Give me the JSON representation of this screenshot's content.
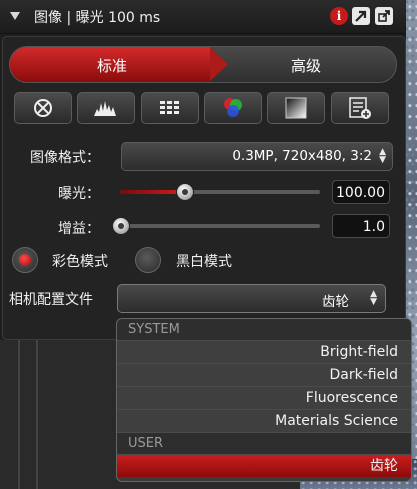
{
  "titlebar": {
    "title": "图像 | 曝光 100 ms"
  },
  "mode_tabs": {
    "standard": "标准",
    "advanced": "高级",
    "active": "标准"
  },
  "toolbar": {
    "icons": [
      "auto-exposure-icon",
      "histogram-icon",
      "grid-icon",
      "color-balance-icon",
      "white-balance-icon",
      "settings-list-icon"
    ]
  },
  "image_format": {
    "label": "图像格式：",
    "value": "0.3MP, 720x480, 3:2"
  },
  "exposure": {
    "label": "曝光：",
    "value": "100.00",
    "slider_fraction": 0.32
  },
  "gain": {
    "label": "增益：",
    "value": "1.0",
    "slider_fraction": 0.0
  },
  "color_modes": {
    "color": "彩色模式",
    "mono": "黑白模式",
    "selected": "color"
  },
  "camera_profile": {
    "label": "相机配置文件",
    "value": "齿轮"
  },
  "dropdown": {
    "system_header": "SYSTEM",
    "system_items": [
      "Bright-field",
      "Dark-field",
      "Fluorescence",
      "Materials Science"
    ],
    "user_header": "USER",
    "user_items": [
      "齿轮"
    ],
    "selected": "齿轮"
  },
  "colors": {
    "accent": "#c41a1a",
    "panel": "#1e1e1e"
  }
}
